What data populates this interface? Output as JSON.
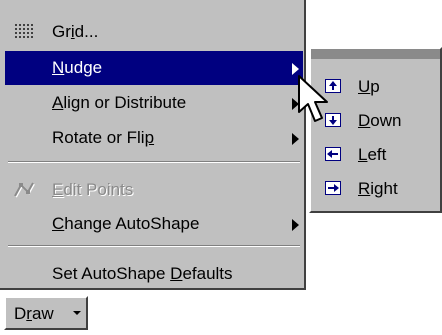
{
  "menu": {
    "items": [
      {
        "pre": "Gr",
        "key": "i",
        "post": "d...",
        "icon": "grid-icon"
      },
      {
        "pre": "",
        "key": "N",
        "post": "udge",
        "submenu": true,
        "selected": true
      },
      {
        "pre": "",
        "key": "A",
        "post": "lign or Distribute",
        "submenu": true
      },
      {
        "pre": "Rotate or Fli",
        "key": "p",
        "post": "",
        "submenu": true
      },
      {
        "pre": "",
        "key": "E",
        "post": "dit Points",
        "disabled": true,
        "icon": "edit-points-icon"
      },
      {
        "pre": "",
        "key": "C",
        "post": "hange AutoShape",
        "submenu": true
      },
      {
        "pre": "Set AutoShape ",
        "key": "D",
        "post": "efaults"
      }
    ]
  },
  "submenu": {
    "items": [
      {
        "pre": "",
        "key": "U",
        "post": "p",
        "icon": "nudge-up-icon"
      },
      {
        "pre": "",
        "key": "D",
        "post": "own",
        "icon": "nudge-down-icon"
      },
      {
        "pre": "",
        "key": "L",
        "post": "eft",
        "icon": "nudge-left-icon"
      },
      {
        "pre": "",
        "key": "R",
        "post": "ight",
        "icon": "nudge-right-icon"
      }
    ]
  },
  "toolbar": {
    "draw": {
      "pre": "D",
      "key": "r",
      "post": "aw"
    }
  },
  "colors": {
    "menu_bg": "#c0c0c0",
    "selection": "#000080",
    "disabled_text": "#8a8a8a"
  }
}
